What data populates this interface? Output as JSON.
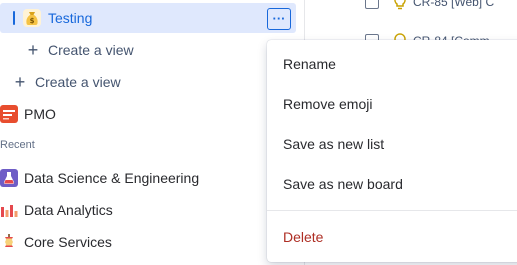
{
  "sidebar": {
    "selected_item": {
      "label": "Testing",
      "icon": "money-bag-icon",
      "more_label": "···"
    },
    "create_view_nested": "Create a view",
    "create_view": "Create a view",
    "space_item": {
      "label": "PMO",
      "icon": "pmo-icon"
    },
    "recent_label": "Recent",
    "recent_items": [
      {
        "label": "Data Science & Engineering",
        "icon": "flask-icon"
      },
      {
        "label": "Data Analytics",
        "icon": "bar-chart-icon"
      },
      {
        "label": "Core Services",
        "icon": "apple-core-icon"
      }
    ]
  },
  "background_list": {
    "rows": [
      {
        "text": "CR-85 [Web] C"
      },
      {
        "text": "CR-84 [Comm"
      }
    ]
  },
  "context_menu": {
    "items": [
      {
        "label": "Rename"
      },
      {
        "label": "Remove emoji"
      },
      {
        "label": "Save as new list"
      },
      {
        "label": "Save as new board"
      }
    ],
    "danger_item": {
      "label": "Delete"
    }
  },
  "colors": {
    "accent": "#1868db",
    "selected_bg": "#dfe8fd",
    "danger": "#ae2e24"
  }
}
